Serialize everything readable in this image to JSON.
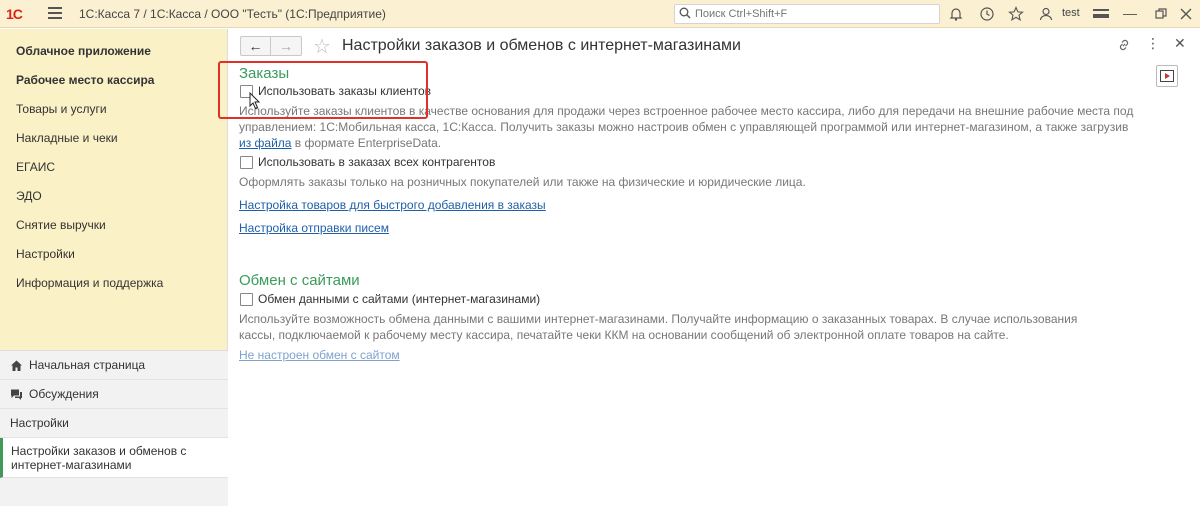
{
  "titlebar": {
    "logo": "1C",
    "title": "1С:Касса 7 / 1С:Касса / ООО \"Тесть\"  (1С:Предприятие)",
    "search_placeholder": "Поиск Ctrl+Shift+F",
    "user": "test"
  },
  "sidebar": {
    "sections": [
      {
        "label": "Облачное приложение",
        "bold": true
      },
      {
        "label": "Рабочее место кассира",
        "bold": true
      },
      {
        "label": "Товары и услуги"
      },
      {
        "label": "Накладные и чеки"
      },
      {
        "label": "ЕГАИС"
      },
      {
        "label": "ЭДО"
      },
      {
        "label": "Снятие выручки"
      },
      {
        "label": "Настройки"
      },
      {
        "label": "Информация и поддержка"
      }
    ],
    "nav": {
      "home": "Начальная страница",
      "discussions": "Обсуждения",
      "settings": "Настройки",
      "active": "Настройки заказов и обменов с интернет-магазинами"
    }
  },
  "main": {
    "title": "Настройки заказов и обменов с интернет-магазинами",
    "orders": {
      "heading": "Заказы",
      "use_orders_label": "Использовать заказы клиентов",
      "use_orders_checked": false,
      "hint_part1": "Используйте заказы клиентов в качестве основания для продажи через встроенное рабочее место кассира, либо для передачи на внешние рабочие места под управлением: 1С:Мобильная касса, 1С:Касса. Получить заказы можно настроив обмен с управляющей программой или интернет-магазином, а также загрузив ",
      "hint_link": "из файла",
      "hint_part2": " в формате EnterpriseData.",
      "all_contractors_label": "Использовать в заказах всех контрагентов",
      "all_contractors_checked": false,
      "all_contractors_hint": "Оформлять заказы только на розничных покупателей или также на физические и юридические лица.",
      "quick_add_link": "Настройка товаров для быстрого добавления в заказы",
      "email_link": "Настройка отправки писем"
    },
    "exchange": {
      "heading": "Обмен с сайтами",
      "exchange_label": "Обмен данными с сайтами (интернет-магазинами)",
      "exchange_checked": false,
      "hint": "Используйте возможность обмена данными с вашими интернет-магазинами. Получайте информацию о заказанных товарах. В случае использования кассы, подключаемой к рабочему месту кассира, печатайте чеки ККМ на основании сообщений об электронной оплате товаров на сайте.",
      "status_link": "Не настроен обмен с сайтом"
    }
  },
  "colors": {
    "accent_green": "#3a9b5c",
    "sidebar_bg": "#fbf1c7",
    "highlight_red": "#e0302a",
    "link_blue": "#1f5fa8"
  }
}
